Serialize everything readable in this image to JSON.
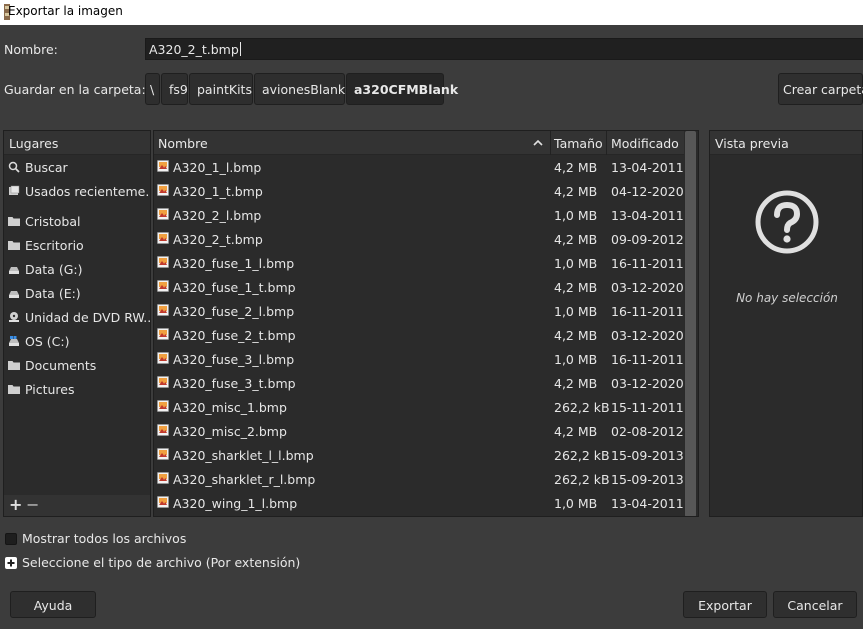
{
  "window": {
    "title": "Exportar la imagen"
  },
  "name_field": {
    "label": "Nombre:",
    "value": "A320_2_t.bmp"
  },
  "folder": {
    "label": "Guardar en la carpeta:",
    "breadcrumbs": [
      "\\",
      "fs9",
      "paintKits",
      "avionesBlank",
      "a320CFMBlank"
    ],
    "create_folder": "Crear carpeta"
  },
  "places": {
    "header": "Lugares",
    "items": [
      {
        "label": "Buscar",
        "icon": "search-icon"
      },
      {
        "label": "Usados recienteme...",
        "icon": "recent-icon"
      },
      {
        "label": "Cristobal",
        "icon": "folder-icon"
      },
      {
        "label": "Escritorio",
        "icon": "folder-icon"
      },
      {
        "label": "Data (G:)",
        "icon": "drive-icon"
      },
      {
        "label": "Data (E:)",
        "icon": "drive-icon"
      },
      {
        "label": "Unidad de DVD RW...",
        "icon": "dvd-icon"
      },
      {
        "label": "OS (C:)",
        "icon": "os-drive-icon"
      },
      {
        "label": "Documents",
        "icon": "folder-icon"
      },
      {
        "label": "Pictures",
        "icon": "folder-icon"
      }
    ],
    "add": "+",
    "remove": "−"
  },
  "files": {
    "columns": {
      "name": "Nombre",
      "size": "Tamaño",
      "modified": "Modificado"
    },
    "rows": [
      {
        "name": "A320_1_l.bmp",
        "size": "4,2 MB",
        "modified": "13-04-2011"
      },
      {
        "name": "A320_1_t.bmp",
        "size": "4,2 MB",
        "modified": "04-12-2020"
      },
      {
        "name": "A320_2_l.bmp",
        "size": "1,0 MB",
        "modified": "13-04-2011"
      },
      {
        "name": "A320_2_t.bmp",
        "size": "4,2 MB",
        "modified": "09-09-2012"
      },
      {
        "name": "A320_fuse_1_l.bmp",
        "size": "1,0 MB",
        "modified": "16-11-2011"
      },
      {
        "name": "A320_fuse_1_t.bmp",
        "size": "4,2 MB",
        "modified": "03-12-2020"
      },
      {
        "name": "A320_fuse_2_l.bmp",
        "size": "1,0 MB",
        "modified": "16-11-2011"
      },
      {
        "name": "A320_fuse_2_t.bmp",
        "size": "4,2 MB",
        "modified": "03-12-2020"
      },
      {
        "name": "A320_fuse_3_l.bmp",
        "size": "1,0 MB",
        "modified": "16-11-2011"
      },
      {
        "name": "A320_fuse_3_t.bmp",
        "size": "4,2 MB",
        "modified": "03-12-2020"
      },
      {
        "name": "A320_misc_1.bmp",
        "size": "262,2 kB",
        "modified": "15-11-2011"
      },
      {
        "name": "A320_misc_2.bmp",
        "size": "4,2 MB",
        "modified": "02-08-2012"
      },
      {
        "name": "A320_sharklet_l_l.bmp",
        "size": "262,2 kB",
        "modified": "15-09-2013"
      },
      {
        "name": "A320_sharklet_r_l.bmp",
        "size": "262,2 kB",
        "modified": "15-09-2013"
      },
      {
        "name": "A320_wing_1_l.bmp",
        "size": "1,0 MB",
        "modified": "13-04-2011"
      }
    ]
  },
  "preview": {
    "header": "Vista previa",
    "empty_text": "No hay selección"
  },
  "options": {
    "show_all": "Mostrar todos los archivos",
    "file_type": "Seleccione el tipo de archivo (Por extensión)"
  },
  "buttons": {
    "help": "Ayuda",
    "export": "Exportar",
    "cancel": "Cancelar"
  },
  "colors": {
    "background": "#3c3c3c",
    "panel": "#2b2b2b",
    "text": "#e6e6e6"
  }
}
